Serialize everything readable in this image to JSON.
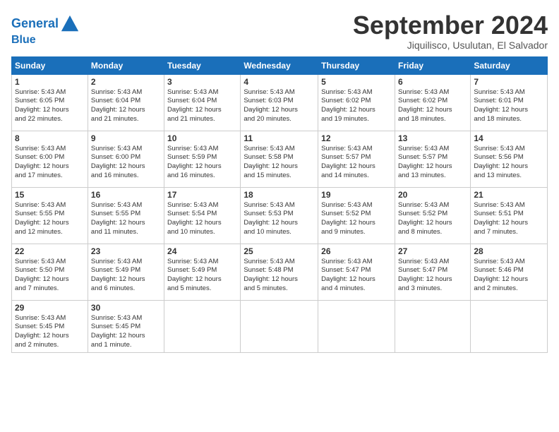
{
  "header": {
    "logo_line1": "General",
    "logo_line2": "Blue",
    "month": "September 2024",
    "location": "Jiquilisco, Usulutan, El Salvador"
  },
  "weekdays": [
    "Sunday",
    "Monday",
    "Tuesday",
    "Wednesday",
    "Thursday",
    "Friday",
    "Saturday"
  ],
  "weeks": [
    [
      {
        "day": "1",
        "info": "Sunrise: 5:43 AM\nSunset: 6:05 PM\nDaylight: 12 hours\nand 22 minutes."
      },
      {
        "day": "2",
        "info": "Sunrise: 5:43 AM\nSunset: 6:04 PM\nDaylight: 12 hours\nand 21 minutes."
      },
      {
        "day": "3",
        "info": "Sunrise: 5:43 AM\nSunset: 6:04 PM\nDaylight: 12 hours\nand 21 minutes."
      },
      {
        "day": "4",
        "info": "Sunrise: 5:43 AM\nSunset: 6:03 PM\nDaylight: 12 hours\nand 20 minutes."
      },
      {
        "day": "5",
        "info": "Sunrise: 5:43 AM\nSunset: 6:02 PM\nDaylight: 12 hours\nand 19 minutes."
      },
      {
        "day": "6",
        "info": "Sunrise: 5:43 AM\nSunset: 6:02 PM\nDaylight: 12 hours\nand 18 minutes."
      },
      {
        "day": "7",
        "info": "Sunrise: 5:43 AM\nSunset: 6:01 PM\nDaylight: 12 hours\nand 18 minutes."
      }
    ],
    [
      {
        "day": "8",
        "info": "Sunrise: 5:43 AM\nSunset: 6:00 PM\nDaylight: 12 hours\nand 17 minutes."
      },
      {
        "day": "9",
        "info": "Sunrise: 5:43 AM\nSunset: 6:00 PM\nDaylight: 12 hours\nand 16 minutes."
      },
      {
        "day": "10",
        "info": "Sunrise: 5:43 AM\nSunset: 5:59 PM\nDaylight: 12 hours\nand 16 minutes."
      },
      {
        "day": "11",
        "info": "Sunrise: 5:43 AM\nSunset: 5:58 PM\nDaylight: 12 hours\nand 15 minutes."
      },
      {
        "day": "12",
        "info": "Sunrise: 5:43 AM\nSunset: 5:57 PM\nDaylight: 12 hours\nand 14 minutes."
      },
      {
        "day": "13",
        "info": "Sunrise: 5:43 AM\nSunset: 5:57 PM\nDaylight: 12 hours\nand 13 minutes."
      },
      {
        "day": "14",
        "info": "Sunrise: 5:43 AM\nSunset: 5:56 PM\nDaylight: 12 hours\nand 13 minutes."
      }
    ],
    [
      {
        "day": "15",
        "info": "Sunrise: 5:43 AM\nSunset: 5:55 PM\nDaylight: 12 hours\nand 12 minutes."
      },
      {
        "day": "16",
        "info": "Sunrise: 5:43 AM\nSunset: 5:55 PM\nDaylight: 12 hours\nand 11 minutes."
      },
      {
        "day": "17",
        "info": "Sunrise: 5:43 AM\nSunset: 5:54 PM\nDaylight: 12 hours\nand 10 minutes."
      },
      {
        "day": "18",
        "info": "Sunrise: 5:43 AM\nSunset: 5:53 PM\nDaylight: 12 hours\nand 10 minutes."
      },
      {
        "day": "19",
        "info": "Sunrise: 5:43 AM\nSunset: 5:52 PM\nDaylight: 12 hours\nand 9 minutes."
      },
      {
        "day": "20",
        "info": "Sunrise: 5:43 AM\nSunset: 5:52 PM\nDaylight: 12 hours\nand 8 minutes."
      },
      {
        "day": "21",
        "info": "Sunrise: 5:43 AM\nSunset: 5:51 PM\nDaylight: 12 hours\nand 7 minutes."
      }
    ],
    [
      {
        "day": "22",
        "info": "Sunrise: 5:43 AM\nSunset: 5:50 PM\nDaylight: 12 hours\nand 7 minutes."
      },
      {
        "day": "23",
        "info": "Sunrise: 5:43 AM\nSunset: 5:49 PM\nDaylight: 12 hours\nand 6 minutes."
      },
      {
        "day": "24",
        "info": "Sunrise: 5:43 AM\nSunset: 5:49 PM\nDaylight: 12 hours\nand 5 minutes."
      },
      {
        "day": "25",
        "info": "Sunrise: 5:43 AM\nSunset: 5:48 PM\nDaylight: 12 hours\nand 5 minutes."
      },
      {
        "day": "26",
        "info": "Sunrise: 5:43 AM\nSunset: 5:47 PM\nDaylight: 12 hours\nand 4 minutes."
      },
      {
        "day": "27",
        "info": "Sunrise: 5:43 AM\nSunset: 5:47 PM\nDaylight: 12 hours\nand 3 minutes."
      },
      {
        "day": "28",
        "info": "Sunrise: 5:43 AM\nSunset: 5:46 PM\nDaylight: 12 hours\nand 2 minutes."
      }
    ],
    [
      {
        "day": "29",
        "info": "Sunrise: 5:43 AM\nSunset: 5:45 PM\nDaylight: 12 hours\nand 2 minutes."
      },
      {
        "day": "30",
        "info": "Sunrise: 5:43 AM\nSunset: 5:45 PM\nDaylight: 12 hours\nand 1 minute."
      },
      {
        "day": "",
        "info": ""
      },
      {
        "day": "",
        "info": ""
      },
      {
        "day": "",
        "info": ""
      },
      {
        "day": "",
        "info": ""
      },
      {
        "day": "",
        "info": ""
      }
    ]
  ]
}
